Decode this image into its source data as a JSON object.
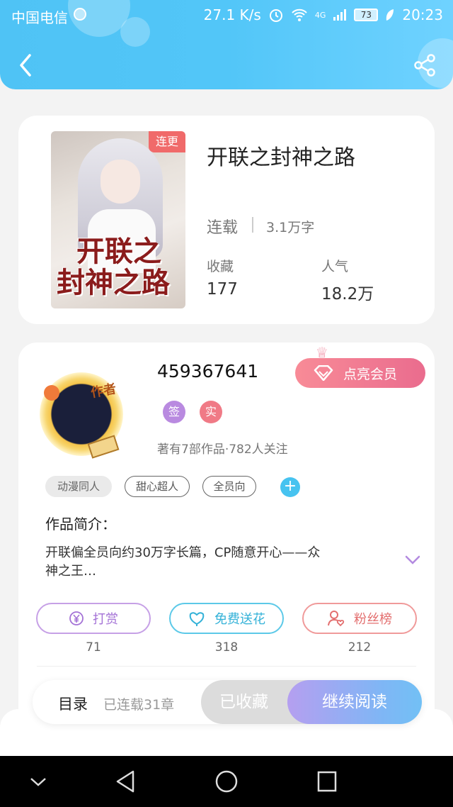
{
  "status_bar": {
    "carrier": "中国电信",
    "speed": "27.1 K/s",
    "network": "4G",
    "battery": "73",
    "time": "20:23"
  },
  "header": {
    "back_icon": "chevron-left-icon",
    "share_icon": "share-icon",
    "accent": "#52c6f8"
  },
  "book": {
    "title": "开联之封神之路",
    "cover_title_line1": "开联之",
    "cover_title_line2": "封神之路",
    "cover_badge": "连更",
    "status": "连载",
    "word_count": "3.1万字",
    "favorites_label": "收藏",
    "favorites_value": "177",
    "popularity_label": "人气",
    "popularity_value": "18.2万"
  },
  "author": {
    "name": "459367641",
    "avatar_tag": "作者",
    "vip_button": "点亮会员",
    "badge_sign": "签",
    "badge_real": "实",
    "meta": "著有7部作品·782人关注",
    "tags": [
      "动漫同人",
      "甜心超人",
      "全员向"
    ],
    "tag_add": "+"
  },
  "intro": {
    "label": "作品简介：",
    "text": "开联偏全员向约30万字长篇，CP随意开心——众神之王…"
  },
  "actions": {
    "reward_label": "打赏",
    "reward_count": "71",
    "flower_label": "免费送花",
    "flower_count": "318",
    "fans_label": "粉丝榜",
    "fans_count": "212"
  },
  "reading_bar": {
    "toc_label": "目录",
    "toc_status": "已连载31章",
    "collected_label": "已收藏",
    "continue_label": "继续阅读"
  },
  "nav_bar": {
    "icons": [
      "chevron-down-icon",
      "back-triangle-icon",
      "home-circle-icon",
      "recents-square-icon"
    ]
  }
}
